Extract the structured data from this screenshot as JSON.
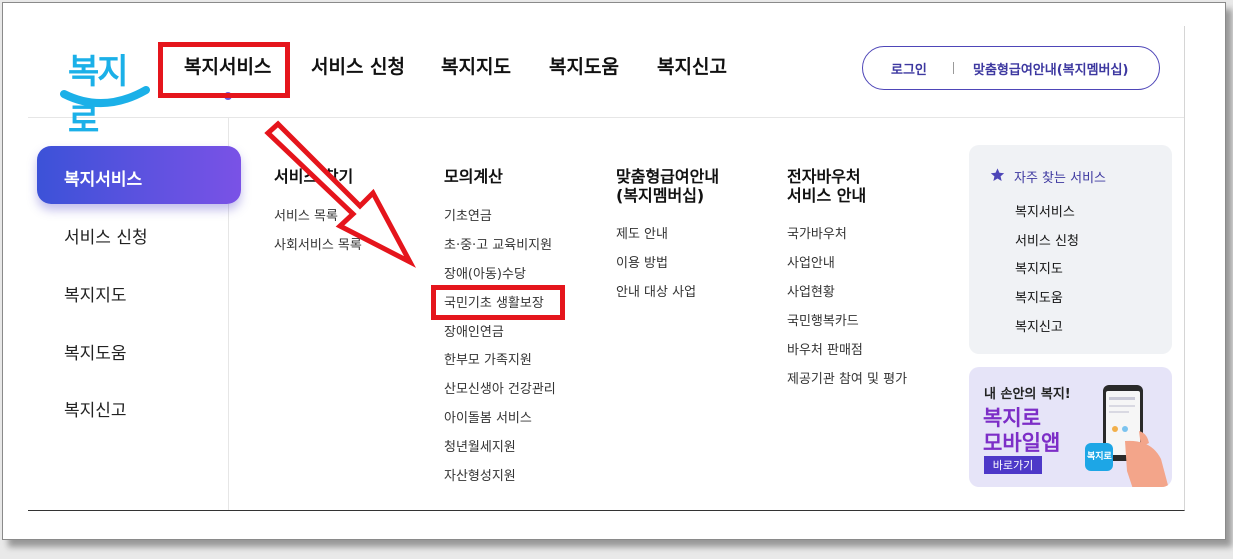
{
  "logo": {
    "text": "복지로"
  },
  "gnb": [
    "복지서비스",
    "서비스 신청",
    "복지지도",
    "복지도움",
    "복지신고"
  ],
  "top_right": {
    "login": "로그인",
    "custom": "맞춤형급여안내(복지멤버십)"
  },
  "sidebar": [
    {
      "label": "복지서비스",
      "active": true
    },
    {
      "label": "서비스 신청",
      "active": false
    },
    {
      "label": "복지지도",
      "active": false
    },
    {
      "label": "복지도움",
      "active": false
    },
    {
      "label": "복지신고",
      "active": false
    }
  ],
  "columns": [
    {
      "title": "서비스 찾기",
      "links": [
        "서비스 목록",
        "사회서비스 목록"
      ]
    },
    {
      "title": "모의계산",
      "links": [
        "기초연금",
        "초·중·고 교육비지원",
        "장애(아동)수당",
        "국민기초 생활보장",
        "장애인연금",
        "한부모 가족지원",
        "산모신생아 건강관리",
        "아이돌봄 서비스",
        "청년월세지원",
        "자산형성지원"
      ]
    },
    {
      "title_line1": "맞춤형급여안내",
      "title_line2": "(복지멤버십)",
      "links": [
        "제도 안내",
        "이용 방법",
        "안내 대상 사업"
      ]
    },
    {
      "title_line1": "전자바우처",
      "title_line2": "서비스 안내",
      "links": [
        "국가바우처",
        "사업안내",
        "사업현황",
        "국민행복카드",
        "바우처 판매점",
        "제공기관 참여 및 평가"
      ]
    }
  ],
  "favorites": {
    "title": "자주 찾는 서비스",
    "items": [
      "복지서비스",
      "서비스 신청",
      "복지지도",
      "복지도움",
      "복지신고"
    ]
  },
  "banner": {
    "small": "내 손안의 복지!",
    "big1": "복지로",
    "big2": "모바일앱",
    "button": "바로가기",
    "app_icon": "복지로"
  },
  "colors": {
    "accent": "#4e46b8",
    "highlight": "#e5151c",
    "logo": "#1bb0e8",
    "banner_text": "#7d2ec7"
  },
  "icons": [
    "star-icon",
    "phone-icon",
    "arrow-annotation"
  ]
}
